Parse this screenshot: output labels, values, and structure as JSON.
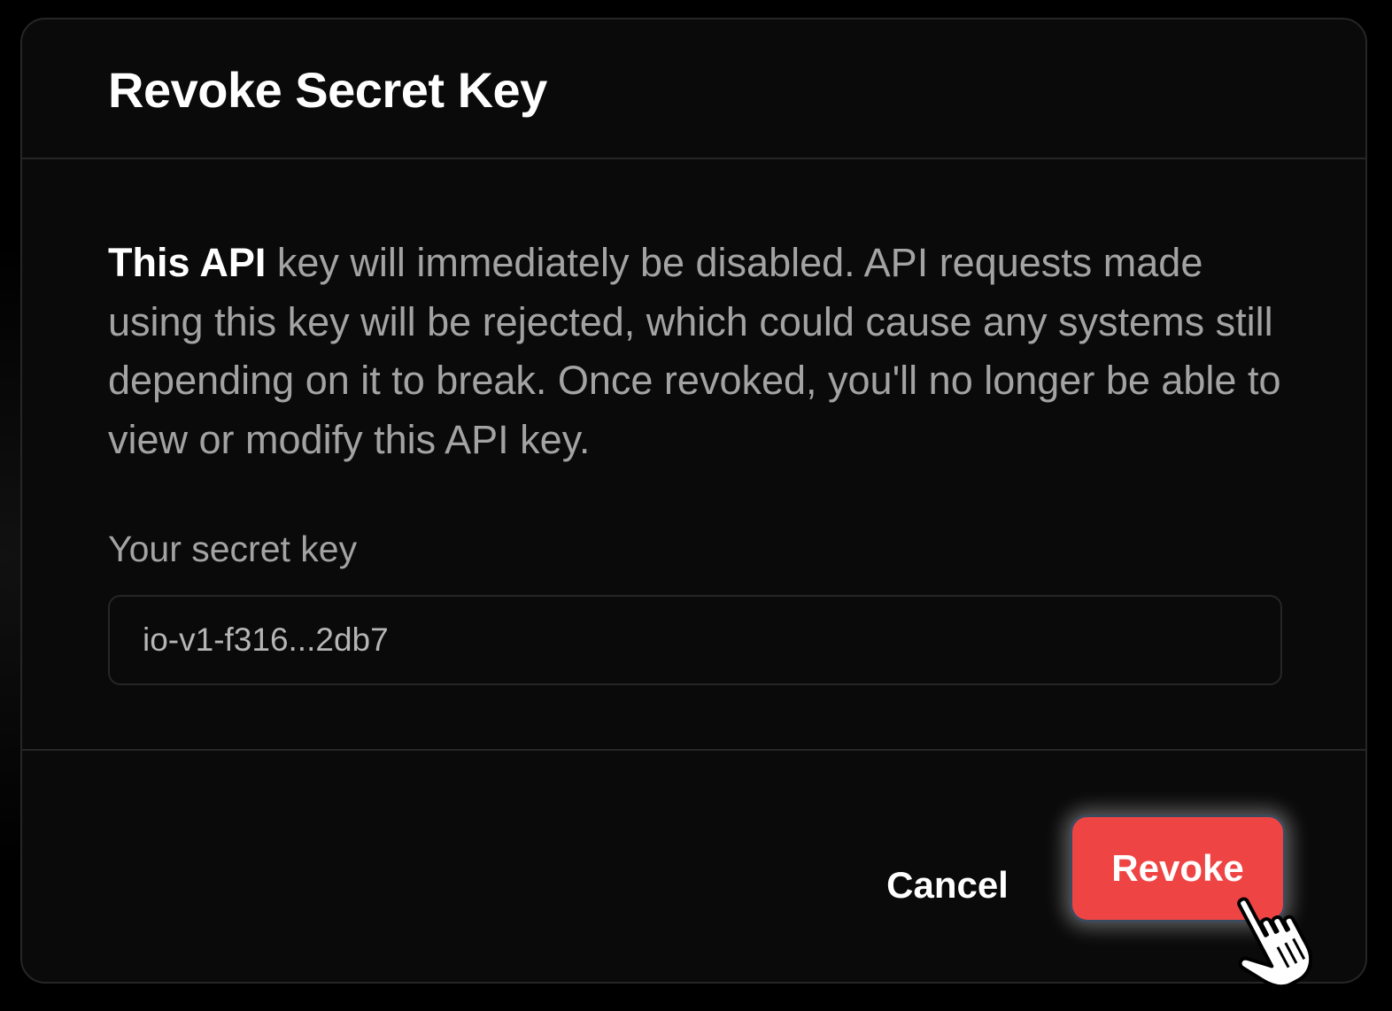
{
  "dialog": {
    "title": "Revoke Secret Key",
    "description_lead": "This API",
    "description_rest": " key will immediately be disabled. API requests made using this key will be rejected, which could cause any systems still depending on it to break. Once revoked, you'll no longer be able to view or modify this API key.",
    "field_label": "Your secret key",
    "field_value": "io-v1-f316...2db7",
    "cancel_label": "Cancel",
    "revoke_label": "Revoke"
  },
  "colors": {
    "background": "#000000",
    "dialog_background": "#0a0a0a",
    "border": "#262626",
    "muted_text": "#a3a3a3",
    "danger": "#ef4444",
    "text": "#ffffff"
  },
  "icons": {
    "cursor": "hand-pointer-icon"
  }
}
